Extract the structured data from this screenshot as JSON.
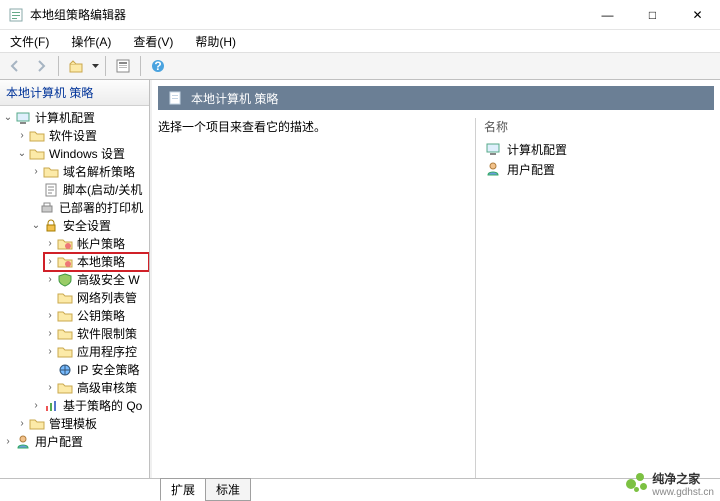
{
  "window": {
    "title": "本地组策略编辑器",
    "controls": {
      "min": "—",
      "max": "□",
      "close": "✕"
    }
  },
  "menu": {
    "file": "文件(F)",
    "action": "操作(A)",
    "view": "查看(V)",
    "help": "帮助(H)"
  },
  "tree": {
    "header": "本地计算机 策略",
    "root_computer": "计算机配置",
    "software_settings": "软件设置",
    "windows_settings": "Windows 设置",
    "dns_policy": "域名解析策略",
    "scripts": "脚本(启动/关机",
    "deployed_printers": "已部署的打印机",
    "security_settings": "安全设置",
    "account_policy": "帐户策略",
    "local_policy": "本地策略",
    "adv_security_w": "高级安全 W",
    "network_list": "网络列表管",
    "public_key": "公钥策略",
    "software_restrict": "软件限制策",
    "app_control": "应用程序控",
    "ip_security": "IP 安全策略",
    "adv_audit": "高级审核策",
    "qos": "基于策略的 Qo",
    "admin_templates": "管理模板",
    "user_config": "用户配置"
  },
  "right": {
    "header": "本地计算机 策略",
    "instruction": "选择一个项目来查看它的描述。",
    "col_name": "名称",
    "item_computer": "计算机配置",
    "item_user": "用户配置"
  },
  "tabs": {
    "extended": "扩展",
    "standard": "标准"
  },
  "watermark": {
    "name": "纯净之家",
    "url": "www.gdhst.cn"
  }
}
